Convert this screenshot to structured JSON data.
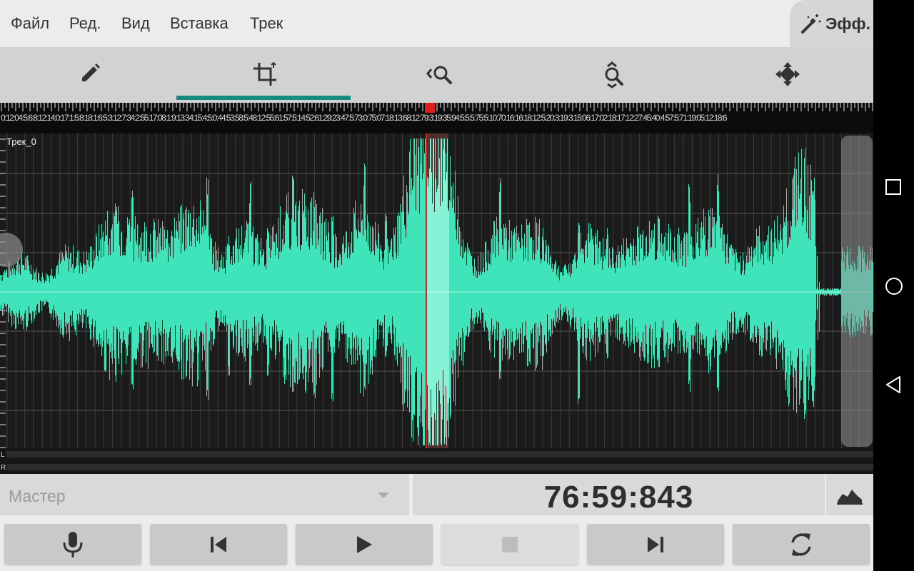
{
  "menu": {
    "items": [
      "Файл",
      "Ред.",
      "Вид",
      "Вставка",
      "Трек"
    ],
    "effects_label": "Эфф."
  },
  "toolbar": {
    "tools": [
      "pencil-icon",
      "crop-icon",
      "zoom-horizontal-icon",
      "zoom-vertical-icon",
      "move-icon"
    ],
    "active_index": 1
  },
  "ruler": {
    "text": "0:12:04:5:6:8:12:14:0:17:1:5:8:18:1:6:5:3:12:7:34:2:55:17:08:1:9:13:34:15:4:5:0:44:53:58:5:48:12:55:61:57:5:14:52:61:29:23:47:5:73:0:75:07:18:13:68:12:79:3:19:35:94:5:5:5:75:5:10:70:16:16:18:12:5:20:3:19:3:15:06:17:02:18:17:12:27:45:40:4:57:5:71:19:05:12:18:6"
  },
  "track": {
    "name": "Трек_0",
    "wave_color": "#3fe4bb",
    "cursor_color": "#dd1f1f"
  },
  "meters": {
    "left": "L",
    "right": "R"
  },
  "mixer": {
    "selected": "Мастер"
  },
  "time": {
    "current": "76:59:843"
  },
  "transport": [
    "record-icon",
    "skip-back-icon",
    "play-icon",
    "stop-icon",
    "skip-forward-icon",
    "loop-icon"
  ],
  "colors": {
    "accent": "#158c7f"
  }
}
